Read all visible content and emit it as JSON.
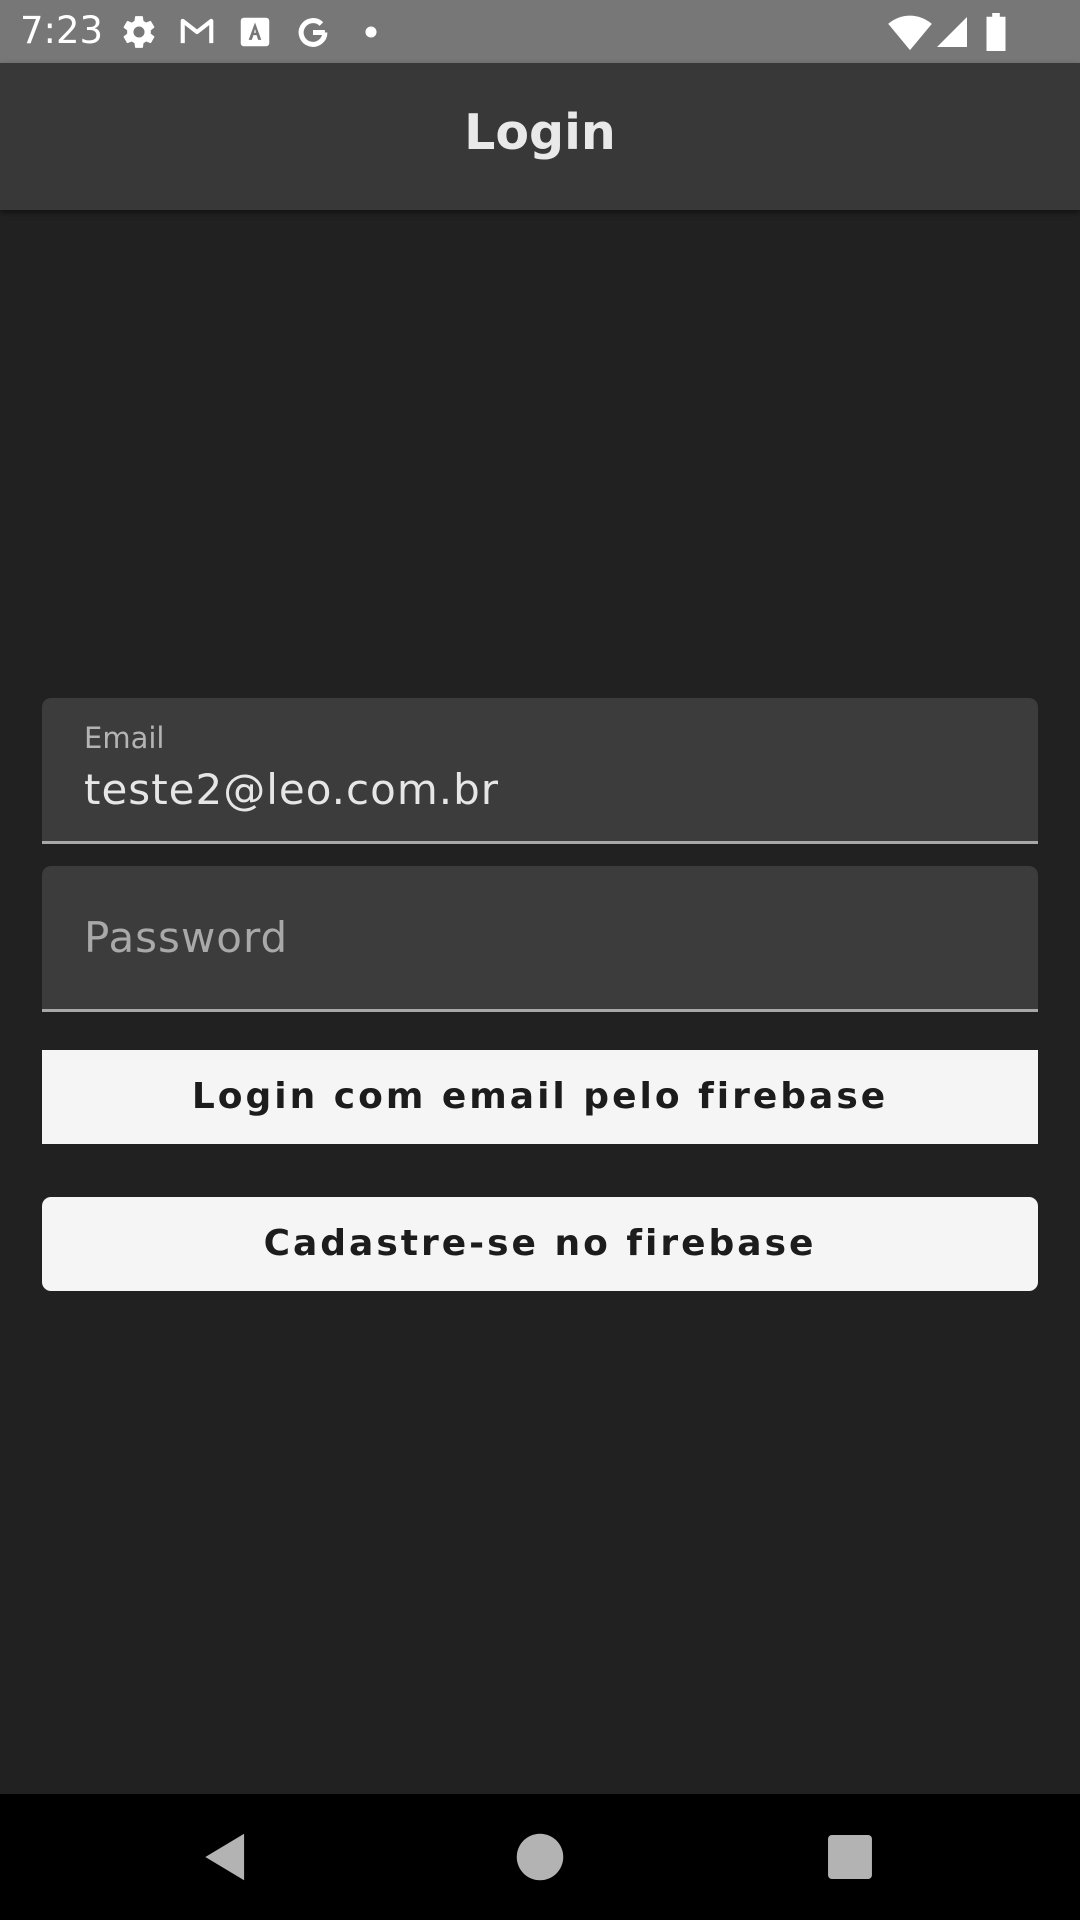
{
  "status_bar": {
    "time": "7:23",
    "icons": [
      "gear-icon",
      "gmail-icon",
      "text-icon",
      "google-icon",
      "dot-icon",
      "wifi-icon",
      "signal-icon",
      "battery-icon"
    ]
  },
  "app_bar": {
    "title": "Login"
  },
  "form": {
    "email": {
      "label": "Email",
      "value": "teste2@leo.com.br"
    },
    "password": {
      "placeholder": "Password"
    },
    "login_button_label": "Login com email pelo firebase",
    "register_button_label": "Cadastre-se no firebase"
  },
  "colors": {
    "background": "#212121",
    "app_bar": "#383838",
    "status_bar": "#777777",
    "field": "#3c3c3c",
    "button": "#f5f5f5"
  },
  "nav_bar": {
    "icons": [
      "back-icon",
      "home-icon",
      "recents-icon"
    ]
  }
}
